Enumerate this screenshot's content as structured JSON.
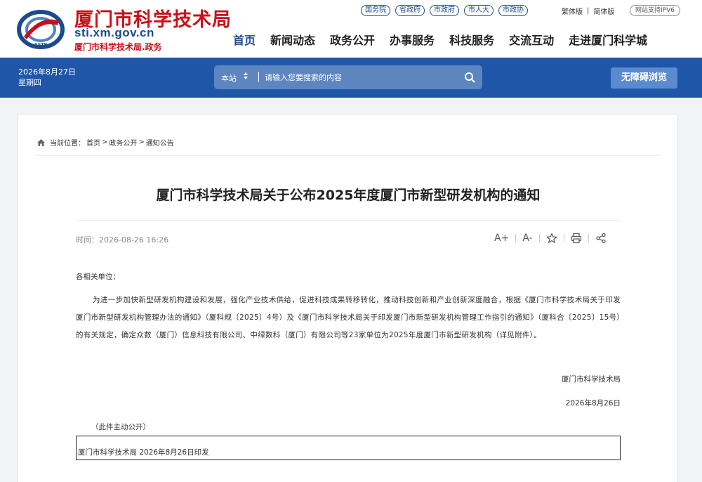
{
  "header": {
    "site_name": "厦门市科学技术局",
    "domain": "sti.xm.gov.cn",
    "subtitle": "厦门市科学技术局.政务",
    "logo_text": "XSTB",
    "gov_links": [
      "国务院",
      "省政府",
      "市政府",
      "市人大",
      "市政协"
    ],
    "lang_traditional": "繁体版",
    "lang_separator": "|",
    "lang_simplified": "简体版",
    "ipv6_label": "网站支持IPV6",
    "nav": [
      "首页",
      "新闻动态",
      "政务公开",
      "办事服务",
      "科技服务",
      "交流互动",
      "走进厦门科学城"
    ],
    "accent_color": "#1f56a8",
    "brand_red": "#c8101a"
  },
  "band": {
    "date": "2026年8月27日",
    "weekday": "星期四",
    "search_scope": "本站",
    "search_scope_arrow": "▲▼",
    "search_placeholder": "请输入您要搜索的内容",
    "accessibility_button": "无障碍浏览"
  },
  "breadcrumb": {
    "prefix": "当前位置：",
    "items": [
      "首页",
      "政务公开",
      "通知公告"
    ],
    "separator": ">"
  },
  "article": {
    "title": "厦门市科学技术局关于公布2025年度厦门市新型研发机构的通知",
    "time_label": "时间：",
    "time": "2026-08-26 16:26",
    "tools": {
      "font_increase": "A+",
      "font_decrease": "A-"
    },
    "salutation": "各相关单位：",
    "paragraph": "为进一步加快新型研发机构建设和发展，强化产业技术供给，促进科技成果转移转化，推动科技创新和产业创新深度融合，根据《厦门市科学技术局关于印发厦门市新型研发机构管理办法的通知》（厦科规〔2025〕4号）及《厦门市科学技术局关于印发厦门市新型研发机构管理工作指引的通知》（厦科合〔2025〕15号）的有关规定，确定众数（厦门）信息科技有限公司、中绿数科（厦门）有限公司等23家单位为2025年度厦门市新型研发机构（详见附件）。",
    "signature_org": "厦门市科学技术局",
    "signature_date": "2026年8月26日",
    "public_note": "（此件主动公开）",
    "issued_line": "厦门市科学技术局  2026年8月26日印发"
  }
}
